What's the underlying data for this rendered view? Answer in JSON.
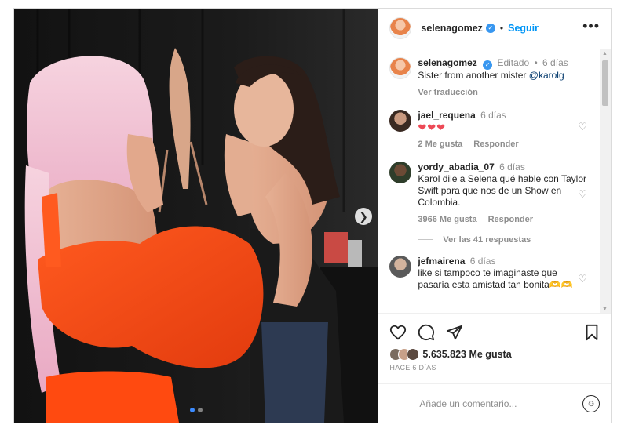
{
  "post_header": {
    "username": "selenagomez",
    "separator": "•",
    "follow_label": "Seguir",
    "more_label": "•••"
  },
  "caption": {
    "username": "selenagomez",
    "status": "Editado",
    "separator": "•",
    "time": "6 días",
    "text": "Sister from another mister",
    "mention": "@karolg",
    "translate_label": "Ver traducción"
  },
  "comments": [
    {
      "username": "jael_requena",
      "time": "6 días",
      "text": "❤❤❤",
      "likes_label": "2 Me gusta",
      "reply_label": "Responder"
    },
    {
      "username": "yordy_abadia_07",
      "time": "6 días",
      "text": "Karol dile a Selena qué hable con Taylor Swift para que nos de un Show en Colombia.",
      "likes_label": "3966 Me gusta",
      "reply_label": "Responder"
    },
    {
      "username": "jefmairena",
      "time": "6 días",
      "text": "like si tampoco te imaginaste que pasaría esta amistad tan bonita🫶🫶",
      "likes_label": "",
      "reply_label": ""
    }
  ],
  "view_replies_label": "Ver las 41 respuestas",
  "likes_count": "5.635.823 Me gusta",
  "date_label": "HACE 6 DÍAS",
  "add_comment": {
    "placeholder": "Añade un comentario..."
  },
  "colors": {
    "accent_blue": "#0095f6",
    "heart_red": "#ed4956",
    "verified_blue": "#3897f0"
  },
  "carousel": {
    "slide_count": 2,
    "active_slide": 1
  }
}
